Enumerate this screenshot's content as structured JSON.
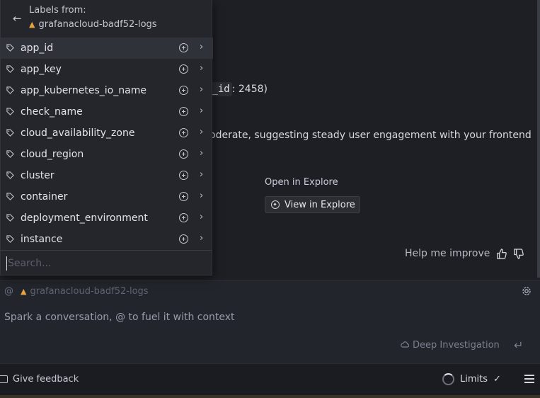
{
  "chat": {
    "line_a": "",
    "line_b_code": "p_id",
    "line_b_rest": ": 2458)",
    "line_c": "oderate, suggesting steady user engagement with your frontend",
    "explore_label": "Open in Explore",
    "explore_button": "View in Explore",
    "improve_label": "Help me improve"
  },
  "dropdown": {
    "title": "Labels from:",
    "source": "grafanacloud-badf52-logs",
    "items": [
      {
        "label": "app_id"
      },
      {
        "label": "app_key"
      },
      {
        "label": "app_kubernetes_io_name"
      },
      {
        "label": "check_name"
      },
      {
        "label": "cloud_availability_zone"
      },
      {
        "label": "cloud_region"
      },
      {
        "label": "cluster"
      },
      {
        "label": "container"
      },
      {
        "label": "deployment_environment"
      },
      {
        "label": "instance"
      }
    ],
    "search_placeholder": "Search..."
  },
  "input": {
    "at_symbol": "@",
    "context_source": "grafanacloud-badf52-logs",
    "placeholder": "Spark a conversation, @ to fuel it with context",
    "deep_investigation": "Deep Investigation"
  },
  "footer": {
    "feedback": "Give feedback",
    "limits": "Limits"
  },
  "colors": {
    "background": "#1e1f24",
    "panel": "#24262c",
    "logo_accent": "#e8a33c"
  }
}
